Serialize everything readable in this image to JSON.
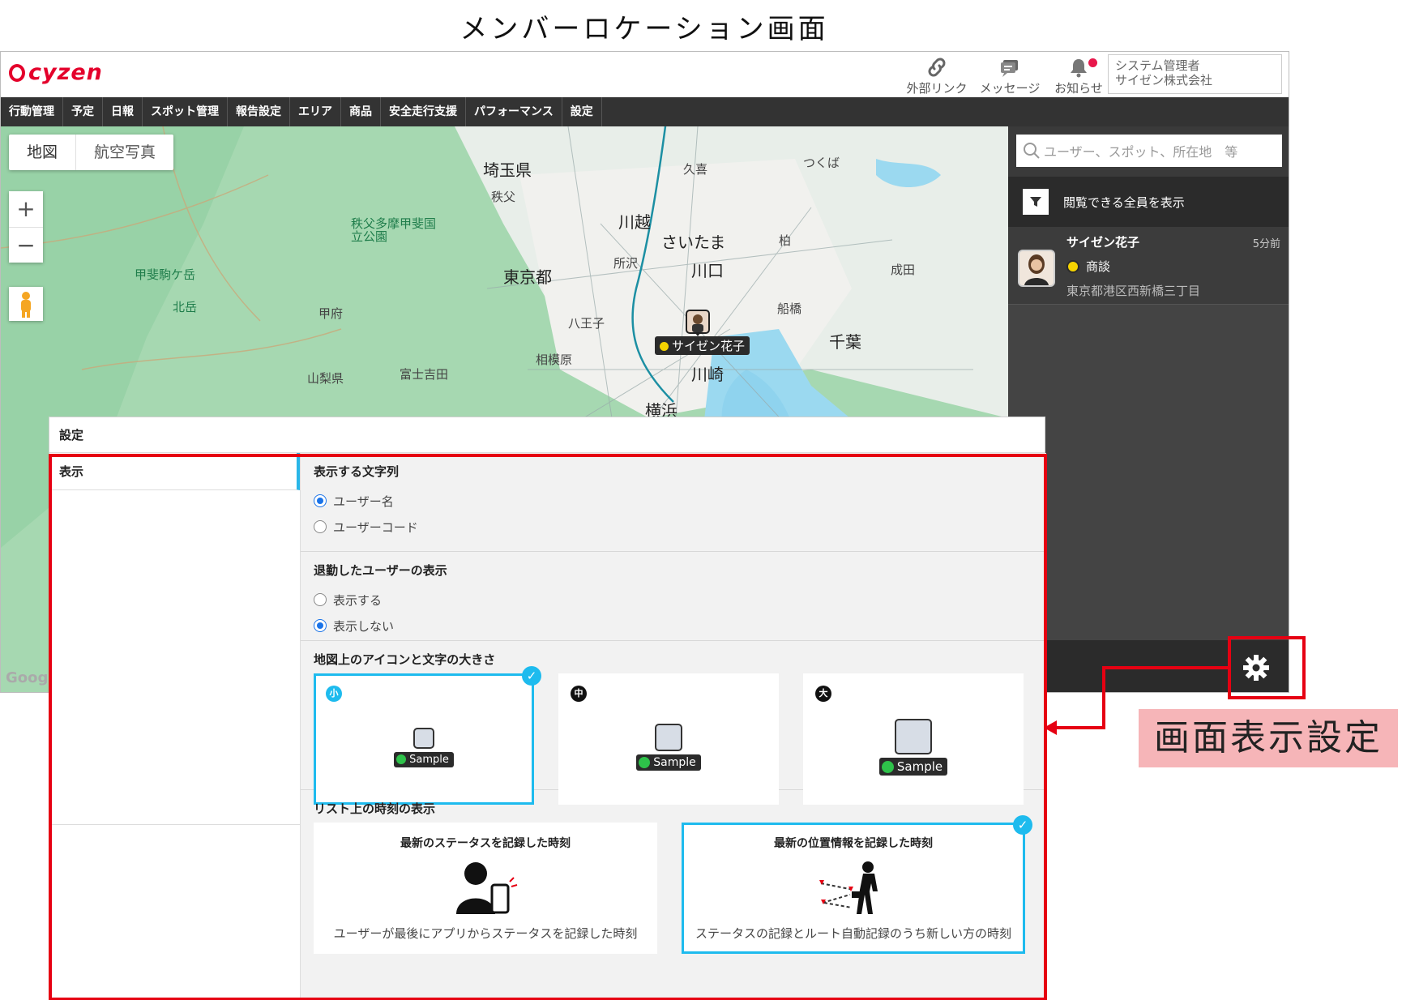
{
  "doc": {
    "title": "メンバーロケーション画面"
  },
  "app": {
    "logo": "cyzen",
    "top_actions": [
      {
        "label": "外部リンク",
        "icon": "link-icon"
      },
      {
        "label": "メッセージ",
        "icon": "message-icon"
      },
      {
        "label": "お知らせ",
        "icon": "bell-icon"
      }
    ],
    "user": {
      "role": "システム管理者",
      "company": "サイゼン株式会社"
    },
    "nav": [
      "行動管理",
      "予定",
      "日報",
      "スポット管理",
      "報告設定",
      "エリア",
      "商品",
      "安全走行支援",
      "パフォーマンス",
      "設定"
    ]
  },
  "map": {
    "tabs": [
      "地図",
      "航空写真"
    ],
    "zoom_in": "+",
    "zoom_out": "−",
    "google": "Goog",
    "labels": {
      "saitama_pref": "埼玉県",
      "tokyo_metro": "東京都",
      "saitama_city": "さいたま",
      "kawagoe": "川越",
      "kawaguchi": "川口",
      "chiba": "千葉",
      "kawasaki": "川崎",
      "yokohama": "横浜",
      "yamanashi": "山梨県",
      "hachioji": "八王子",
      "sagamihara": "相模原",
      "funabashi": "船橋",
      "kai_komagatake": "甲斐駒ケ岳",
      "kitadake": "北岳",
      "chichibu_park": "秩父多摩甲斐国立公園",
      "kashiwa": "柏",
      "tsukuba": "つくば",
      "narita": "成田",
      "chichibu": "秩父",
      "kuki": "久喜",
      "tokorozawa": "所沢",
      "fujiyoshida": "富士吉田",
      "kofu": "甲府"
    },
    "member_tag": "サイゼン花子"
  },
  "side": {
    "search_placeholder": "ユーザー、スポット、所在地　等",
    "filter_label": "閲覧できる全員を表示",
    "members": [
      {
        "name": "サイゼン花子",
        "time": "5分前",
        "status": "商談",
        "address": "東京都港区西新橋三丁目"
      }
    ]
  },
  "settings": {
    "header": "設定",
    "menu": [
      "表示"
    ],
    "display_text": {
      "title": "表示する文字列",
      "options": [
        "ユーザー名",
        "ユーザーコード"
      ],
      "selected": 0
    },
    "retired": {
      "title": "退勤したユーザーの表示",
      "options": [
        "表示する",
        "表示しない"
      ],
      "selected": 1
    },
    "icon_size": {
      "title": "地図上のアイコンと文字の大きさ",
      "options": [
        {
          "badge": "小",
          "sample": "Sample"
        },
        {
          "badge": "中",
          "sample": "Sample"
        },
        {
          "badge": "大",
          "sample": "Sample"
        }
      ],
      "selected": 0
    },
    "list_time": {
      "title": "リスト上の時刻の表示",
      "options": [
        {
          "title": "最新のステータスを記録した時刻",
          "desc": "ユーザーが最後にアプリからステータスを記録した時刻"
        },
        {
          "title": "最新の位置情報を記録した時刻",
          "desc": "ステータスの記録とルート自動記録のうち新しい方の時刻"
        }
      ],
      "selected": 1
    }
  },
  "annotation": {
    "callout": "画面表示設定"
  },
  "colors": {
    "accent": "#1ebbee",
    "highlight": "#e60012",
    "callout_bg": "#f6b5b8",
    "brand": "#e4002b"
  }
}
